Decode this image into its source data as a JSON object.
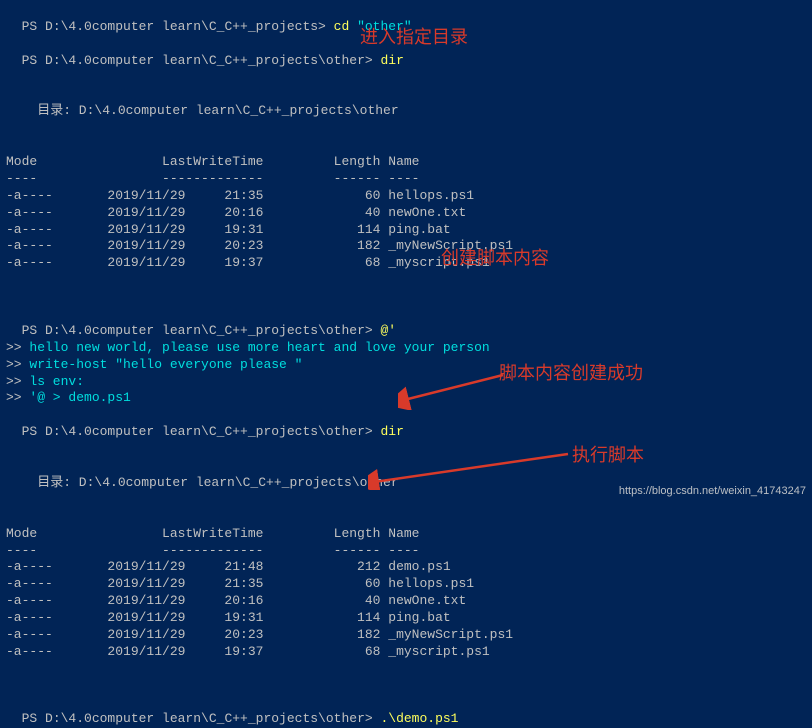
{
  "prompt_path": "PS D:\\4.0computer learn\\C_C++_projects>",
  "prompt_path_other": "PS D:\\4.0computer learn\\C_C++_projects\\other>",
  "cmd_cd": " cd ",
  "cd_arg": "\"other\"",
  "cmd_dir": " dir",
  "dir_heading": "    目录: D:\\4.0computer learn\\C_C++_projects\\other",
  "col_header": "Mode                LastWriteTime         Length Name",
  "col_rule": "----                -------------         ------ ----",
  "listing1": [
    "-a----       2019/11/29     21:35             60 hellops.ps1",
    "-a----       2019/11/29     20:16             40 newOne.txt",
    "-a----       2019/11/29     19:31            114 ping.bat",
    "-a----       2019/11/29     20:23            182 _myNewScript.ps1",
    "-a----       2019/11/29     19:37             68 _myscript.ps1"
  ],
  "at_cmd": " @'",
  "cont_prefix": ">> ",
  "here_lines": [
    "hello new world, please use more heart and love your person",
    "write-host \"hello everyone please \"",
    "ls env:",
    "'@ > demo.ps1"
  ],
  "listing2": [
    "-a----       2019/11/29     21:48            212 demo.ps1",
    "-a----       2019/11/29     21:35             60 hellops.ps1",
    "-a----       2019/11/29     20:16             40 newOne.txt",
    "-a----       2019/11/29     19:31            114 ping.bat",
    "-a----       2019/11/29     20:23            182 _myNewScript.ps1",
    "-a----       2019/11/29     19:37             68 _myscript.ps1"
  ],
  "cmd_run": " .\\demo.ps1",
  "annot1": "进入指定目录",
  "annot2": "创建脚本内容",
  "annot3": "脚本内容创建成功",
  "annot4": "执行脚本",
  "watermark": "https://blog.csdn.net/weixin_41743247"
}
